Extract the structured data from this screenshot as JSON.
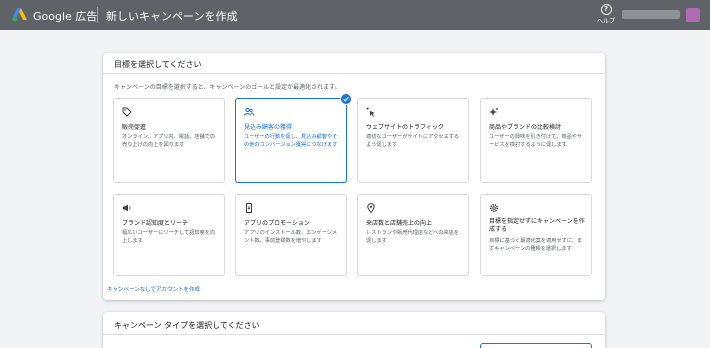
{
  "colors": {
    "topbar": "#5f6368",
    "accent": "#1a73e8",
    "background": "#f1f3f4"
  },
  "header": {
    "brand": "Google 広告",
    "title": "新しいキャンペーンを作成",
    "help_label": "ヘルプ"
  },
  "goal_section": {
    "title": "目標を選択してください",
    "description": "キャンペーンの目標を選択すると、キャンペーンのゴールと設定が最適化されます。",
    "tiles": [
      {
        "icon": "tag-icon",
        "title": "販売促進",
        "desc": "オンライン、アプリ内、電話、店舗での売り上げの向上を図ります",
        "selected": false
      },
      {
        "icon": "people-icon",
        "title": "見込み顧客の獲得",
        "desc": "ユーザーの行動を促し、見込み顧客やその他のコンバージョン獲得につなげます",
        "selected": true
      },
      {
        "icon": "cursor-click-icon",
        "title": "ウェブサイトのトラフィック",
        "desc": "適切なユーザーがサイトにアクセスするよう促します",
        "selected": false
      },
      {
        "icon": "sparkle-icon",
        "title": "商品やブランドの比較検討",
        "desc": "ユーザーの興味を引き付けて、商品やサービスを検討するように促します",
        "selected": false
      },
      {
        "icon": "speaker-icon",
        "title": "ブランド認知度とリーチ",
        "desc": "幅広いユーザーにリーチして認知度を向上します",
        "selected": false
      },
      {
        "icon": "phone-icon",
        "title": "アプリのプロモーション",
        "desc": "アプリのインストール数、エンゲージメント数、事前登録数を増やします",
        "selected": false
      },
      {
        "icon": "location-pin-icon",
        "title": "来店数と店舗売上の向上",
        "desc": "レストランや販売代理店などへの来店を促します",
        "selected": false
      },
      {
        "icon": "gear-icon",
        "title": "目標を指定せずにキャンペーンを作成する",
        "desc": "目標に基づく最適化案を適用せずに、まずキャンペーンの種類を選択します",
        "selected": false
      }
    ],
    "no_goal_link": "キャンペーンなしでアカウントを作成"
  },
  "campaign_type_section": {
    "title": "キャンペーン タイプを選択してください"
  }
}
